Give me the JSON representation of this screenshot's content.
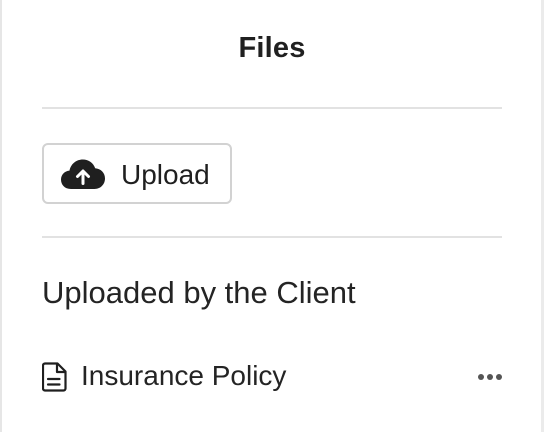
{
  "panel": {
    "title": "Files",
    "upload_button": {
      "label": "Upload",
      "icon": "cloud-upload-icon"
    },
    "section": {
      "title": "Uploaded by the Client"
    },
    "files": [
      {
        "name": "Insurance Policy",
        "icon": "document-icon",
        "menu_icon": "more-horizontal-icon"
      }
    ]
  },
  "colors": {
    "text": "#1f1f1f",
    "divider": "#e2e2e2",
    "button_border": "#d2d2d2",
    "icon": "#1f1f1f",
    "menu_icon": "#555555"
  }
}
